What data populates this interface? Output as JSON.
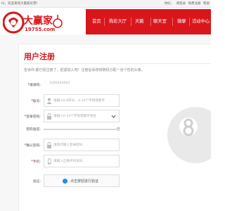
{
  "topbar": {
    "welcome": "Hi，欢迎来到大赢家彩票!",
    "links": [
      "你好，",
      "请登录",
      "免费注册",
      "帮助"
    ]
  },
  "logo": {
    "brand": "大赢家",
    "domain": "19755.com"
  },
  "nav": {
    "items": [
      "首页",
      "购彩大厅",
      "天籁",
      "聊天室",
      "微聊",
      "活动中心"
    ]
  },
  "page": {
    "title": "用户注册",
    "subtitle": "告诉你·都已经注册了，赶紧加入吧！注册后系统将随机分配一张个性的头像。"
  },
  "form": {
    "invite": {
      "label": "邀请码:",
      "value": "1000403093"
    },
    "account": {
      "label": "账号:",
      "placeholder": "请输入6-8开头、4-16个字母或数字"
    },
    "password": {
      "label": "登录密码:",
      "placeholder": "请输入6-14个字母或数字组合"
    },
    "strength": {
      "label": "密码强度:",
      "end_label": "空"
    },
    "confirm": {
      "label": "确认密码:",
      "placeholder": "请再次输入登录密码"
    },
    "phone": {
      "label": "手机:",
      "placeholder": "请输入正确手机号码"
    },
    "verify": {
      "label": "验证:",
      "button": "点击按钮进行验证"
    }
  },
  "colors": {
    "brand_red": "#d9161c",
    "verify_blue": "#1e8ee8"
  }
}
